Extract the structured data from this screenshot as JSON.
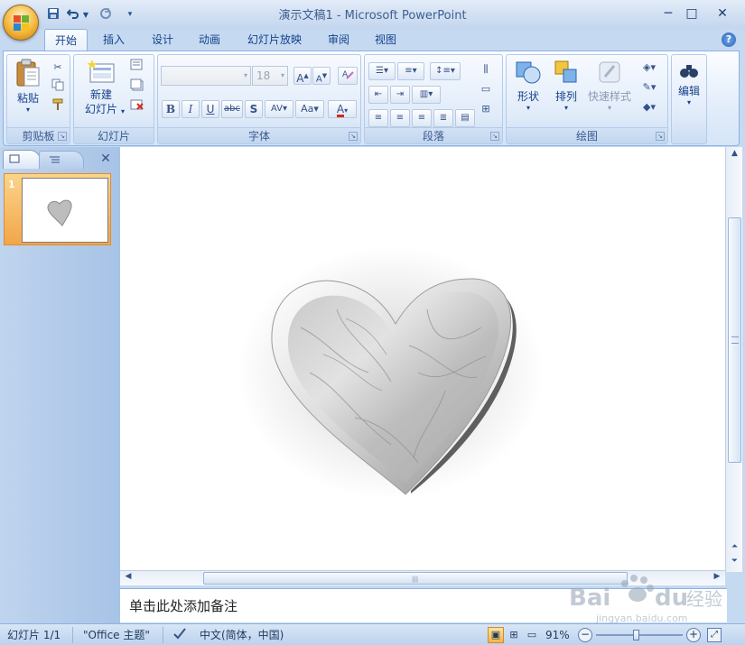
{
  "app": {
    "title": "演示文稿1 - Microsoft PowerPoint"
  },
  "quick_access": {
    "save_icon": "save-icon",
    "undo_icon": "undo-icon",
    "redo_icon": "redo-icon",
    "customize_icon": "customize-qat-icon"
  },
  "window_controls": {
    "minimize": "─",
    "maximize": "□",
    "close": "✕"
  },
  "tabs": [
    {
      "label": "开始",
      "active": true
    },
    {
      "label": "插入"
    },
    {
      "label": "设计"
    },
    {
      "label": "动画"
    },
    {
      "label": "幻灯片放映"
    },
    {
      "label": "审阅"
    },
    {
      "label": "视图"
    }
  ],
  "ribbon": {
    "clipboard": {
      "label": "剪贴板",
      "paste": "粘贴"
    },
    "slides": {
      "label": "幻灯片",
      "new_slide_line1": "新建",
      "new_slide_line2": "幻灯片"
    },
    "font": {
      "label": "字体",
      "font_name": "",
      "font_size": "18"
    },
    "paragraph": {
      "label": "段落"
    },
    "drawing": {
      "label": "绘图",
      "shapes": "形状",
      "arrange": "排列",
      "quick_styles": "快速样式"
    },
    "editing": {
      "label": "编辑"
    }
  },
  "slide_panel": {
    "slide_number": "1"
  },
  "notes": {
    "placeholder": "单击此处添加备注"
  },
  "status": {
    "slide": "幻灯片 1/1",
    "theme": "\"Office 主题\"",
    "language": "中文(简体，中国)",
    "zoom": "91%",
    "zoom_level": 0.91
  },
  "watermark": {
    "text": "Bai du 经验",
    "sub": "jingyan.baidu.com"
  },
  "colors": {
    "accent": "#15428b",
    "ribbon_bg": "#dfeaf8",
    "selection": "#f4a742"
  }
}
